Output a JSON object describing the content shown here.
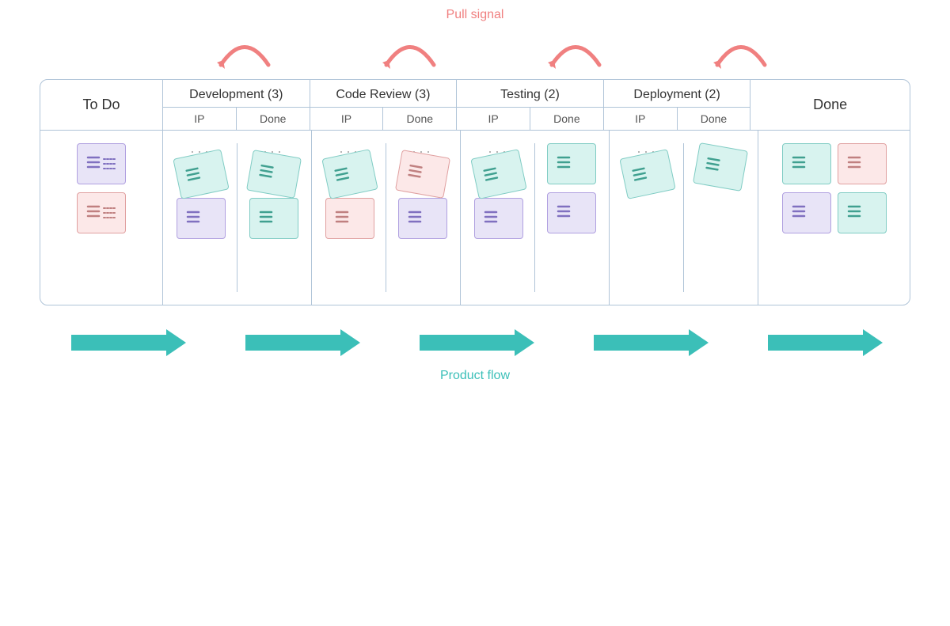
{
  "pull_signal": {
    "label": "Pull signal"
  },
  "product_flow": {
    "label": "Product flow"
  },
  "columns": {
    "todo": "To Do",
    "done": "Done",
    "groups": [
      {
        "title": "Development (3)",
        "sub": [
          "IP",
          "Done"
        ]
      },
      {
        "title": "Code Review (3)",
        "sub": [
          "IP",
          "Done"
        ]
      },
      {
        "title": "Testing (2)",
        "sub": [
          "IP",
          "Done"
        ]
      },
      {
        "title": "Deployment (2)",
        "sub": [
          "IP",
          "Done"
        ]
      }
    ]
  }
}
